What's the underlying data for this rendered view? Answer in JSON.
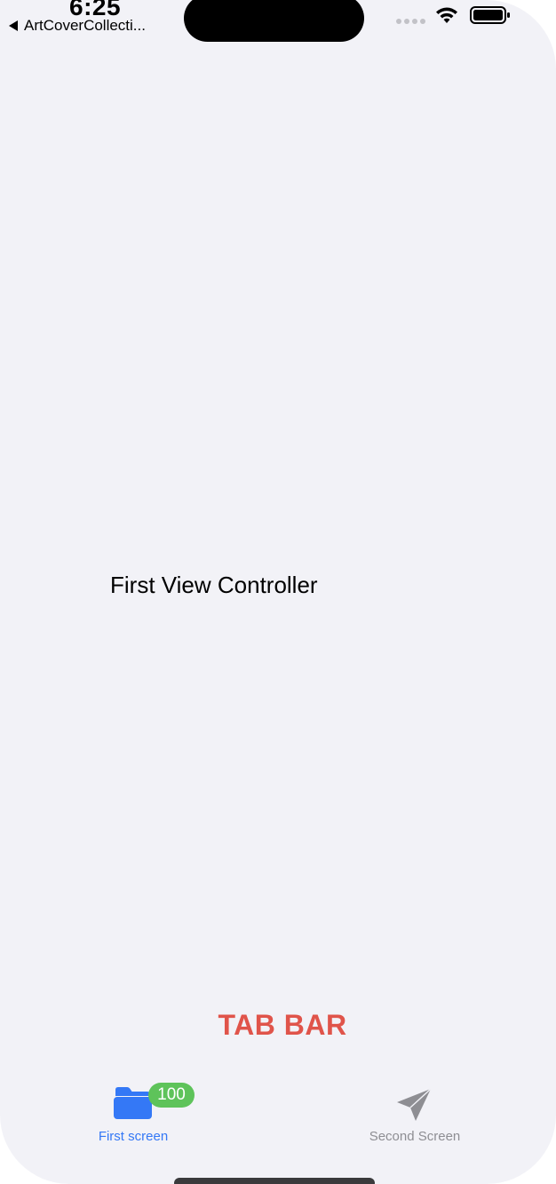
{
  "status_bar": {
    "time": "6:25",
    "back_app": "ArtCoverCollecti..."
  },
  "main": {
    "center_label": "First View Controller"
  },
  "annotation": {
    "tab_bar_label": "TAB BAR"
  },
  "tab_bar": {
    "items": [
      {
        "label": "First screen",
        "icon": "folder-icon",
        "badge": "100",
        "selected": true
      },
      {
        "label": "Second Screen",
        "icon": "paper-plane-icon",
        "selected": false
      }
    ]
  },
  "colors": {
    "background": "#f2f2f7",
    "tab_selected": "#3478f6",
    "tab_unselected": "#8e8e93",
    "badge": "#5ec35a",
    "annotation": "#e0544a"
  }
}
